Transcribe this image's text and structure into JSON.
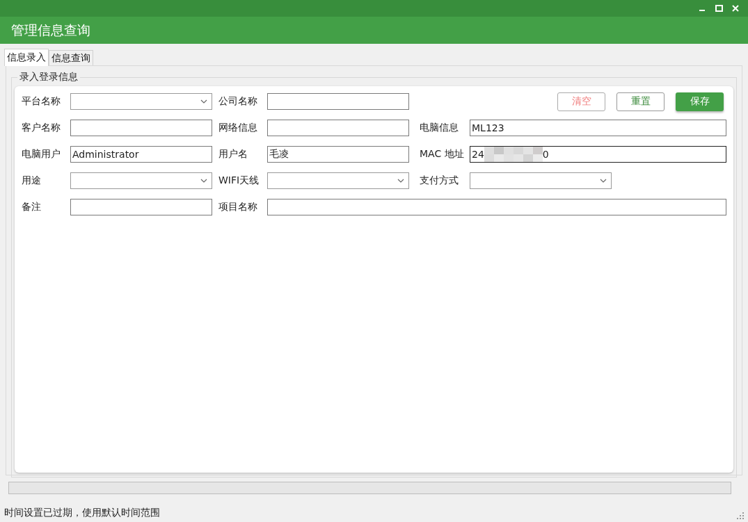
{
  "window": {
    "title": "管理信息查询"
  },
  "tabs": [
    {
      "label": "信息录入",
      "selected": true
    },
    {
      "label": "信息查询",
      "selected": false
    }
  ],
  "group": {
    "title": "录入登录信息"
  },
  "buttons": [
    {
      "label": "清空",
      "kind": "clear"
    },
    {
      "label": "重置",
      "kind": "reset"
    },
    {
      "label": "保存",
      "kind": "save"
    }
  ],
  "rows": [
    [
      {
        "label": "平台名称",
        "kind": "combo"
      },
      {
        "label": "公司名称",
        "kind": "text"
      }
    ],
    [
      {
        "label": "客户名称",
        "kind": "text"
      },
      {
        "label": "网络信息",
        "kind": "text"
      },
      {
        "label": "电脑信息",
        "kind": "text",
        "value": "ML123"
      }
    ],
    [
      {
        "label": "电脑用户",
        "kind": "text",
        "value": "Administrator"
      },
      {
        "label": "用户名",
        "kind": "text",
        "value": "毛凌"
      },
      {
        "label": "MAC 地址",
        "kind": "masked",
        "value_start": "24",
        "value_end": "0"
      }
    ],
    [
      {
        "label": "用途",
        "kind": "combo"
      },
      {
        "label": "WIFI天线",
        "kind": "combo"
      },
      {
        "label": "支付方式",
        "kind": "combo"
      }
    ],
    [
      {
        "label": "备注",
        "kind": "text"
      },
      {
        "label": "项目名称",
        "kind": "text"
      }
    ]
  ],
  "progress": {
    "level": 0
  },
  "status_bar": {
    "text": "时间设置已过期，使用默认时间范围"
  }
}
